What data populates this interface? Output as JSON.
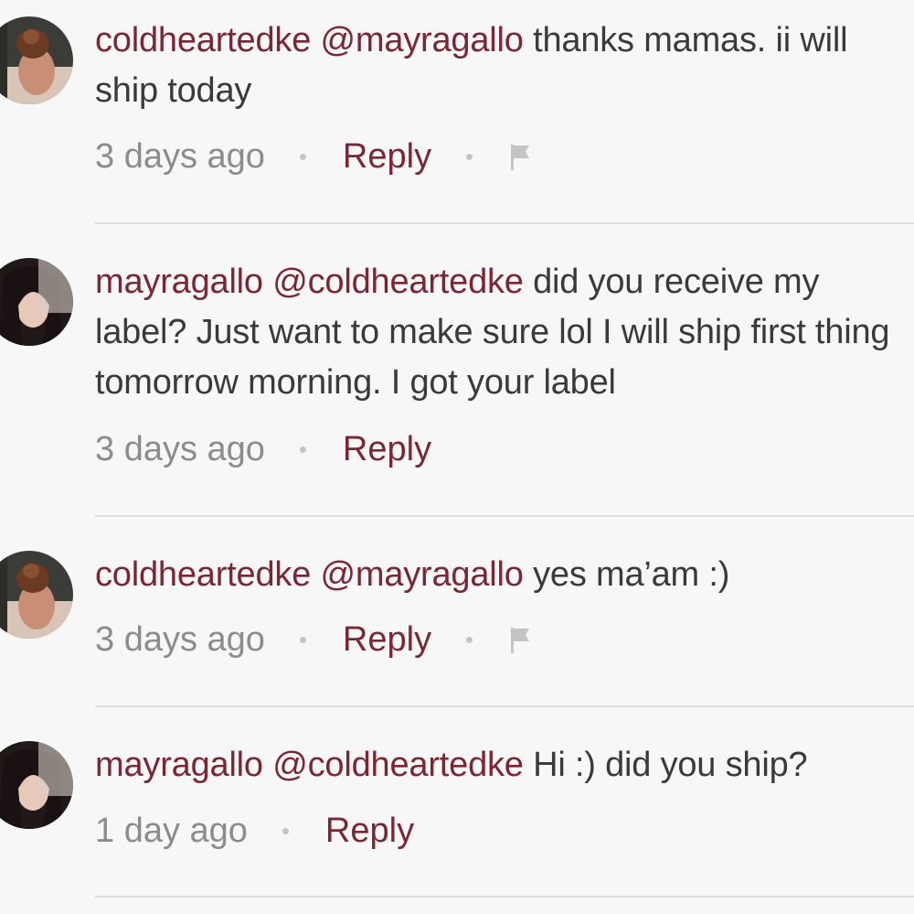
{
  "comments": [
    {
      "username": "coldheartedke",
      "mention": "@mayragallo",
      "text": "thanks mamas. ii will ship today",
      "time": "3 days ago",
      "reply_label": "Reply",
      "has_flag": true,
      "avatar": "avatar-coldheartedke"
    },
    {
      "username": "mayragallo",
      "mention": "@coldheartedke",
      "text": "did you receive my label? Just want to make sure lol I will ship first thing tomorrow morning. I got your label",
      "time": "3 days ago",
      "reply_label": "Reply",
      "has_flag": false,
      "avatar": "avatar-mayragallo"
    },
    {
      "username": "coldheartedke",
      "mention": "@mayragallo",
      "text": "yes ma’am :)",
      "time": "3 days ago",
      "reply_label": "Reply",
      "has_flag": true,
      "avatar": "avatar-coldheartedke"
    },
    {
      "username": "mayragallo",
      "mention": "@coldheartedke",
      "text": "Hi :) did you ship?",
      "time": "1 day ago",
      "reply_label": "Reply",
      "has_flag": false,
      "avatar": "avatar-mayragallo"
    }
  ],
  "colors": {
    "accent": "#7a2635",
    "text": "#3a3a3a",
    "meta": "#8c8c8c",
    "background": "#f7f7f7"
  }
}
